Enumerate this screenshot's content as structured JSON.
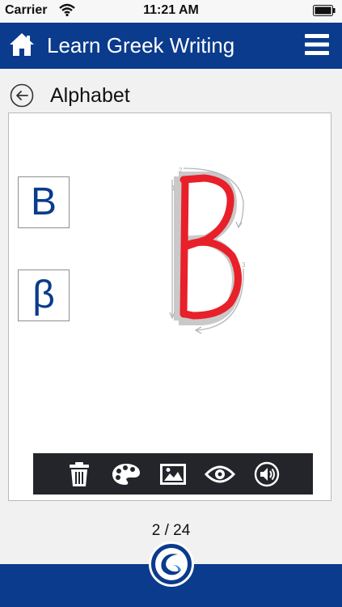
{
  "status_bar": {
    "carrier": "Carrier",
    "time": "11:21 AM"
  },
  "header": {
    "title": "Learn Greek Writing",
    "icons": {
      "left": "home-icon",
      "right": "menu-icon"
    }
  },
  "section": {
    "title": "Alphabet",
    "back_icon": "back-arrow-icon"
  },
  "letters": {
    "upper": "Β",
    "lower": "β"
  },
  "trace_guide_numbers": [
    "1",
    "2",
    "3"
  ],
  "toolbar": {
    "buttons": [
      "trash-icon",
      "palette-icon",
      "image-icon",
      "eye-icon",
      "speaker-icon"
    ]
  },
  "pager": {
    "text": "2 / 24"
  },
  "colors": {
    "header_blue": "#0a3b8c",
    "stroke_red": "#e8202a",
    "guide_gray": "#c4c4c4",
    "toolbar_bg": "#23252a"
  }
}
